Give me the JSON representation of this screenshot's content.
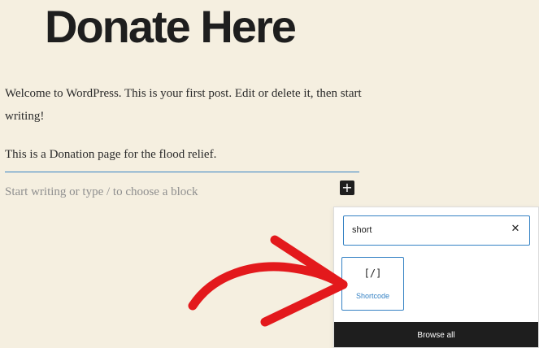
{
  "post": {
    "title": "Donate Here",
    "paragraph_1": "Welcome to WordPress. This is your first post. Edit or delete it, then start writing!",
    "paragraph_2": "This is a Donation page for the flood relief.",
    "placeholder": "Start writing or type / to choose a block",
    "add_block_icon": "plus-icon"
  },
  "inserter": {
    "search_value": "short",
    "clear_icon": "close-icon",
    "results": [
      {
        "icon": "shortcode-icon",
        "icon_glyph": "[/]",
        "label": "Shortcode"
      }
    ],
    "browse_all_label": "Browse all"
  },
  "annotation": {
    "arrow_color": "#e3191c",
    "arrow_icon": "red-arrow"
  },
  "colors": {
    "accent": "#3582c4",
    "background": "#f5efe0",
    "dark": "#1e1e1e"
  }
}
